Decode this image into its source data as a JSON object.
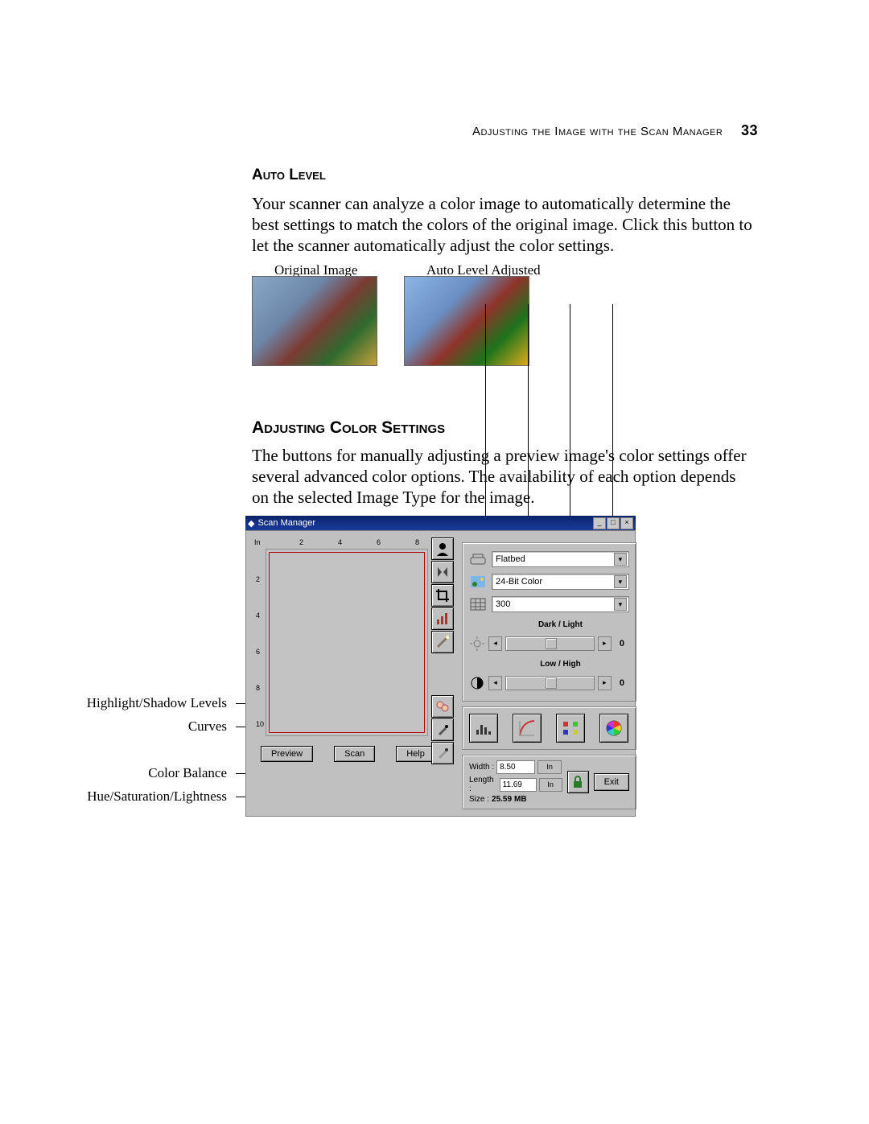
{
  "running_head": {
    "text": "Adjusting the Image with the Scan Manager",
    "page_number": "33"
  },
  "section_auto_level": {
    "heading": "Auto Level",
    "body": "Your scanner can analyze a color image to automatically determine the best settings to match the colors of the original image. Click this button to let the scanner automatically adjust the color settings.",
    "original_caption": "Original Image",
    "adjusted_caption": "Auto Level Adjusted"
  },
  "section_color_settings": {
    "heading": "Adjusting Color Settings",
    "body": "The buttons for manually adjusting a preview image's color settings offer several advanced color options. The availability of each option depends on the selected Image Type for the image."
  },
  "callouts": {
    "highlight_shadow": "Highlight/Shadow Levels",
    "curves": "Curves",
    "color_balance": "Color Balance",
    "hsl": "Hue/Saturation/Lightness"
  },
  "scan_manager": {
    "title": "Scan Manager",
    "ruler_unit_label": "In",
    "ruler_h_ticks": [
      "2",
      "4",
      "6",
      "8"
    ],
    "ruler_v_ticks": [
      "2",
      "4",
      "6",
      "8",
      "10"
    ],
    "buttons": {
      "preview": "Preview",
      "scan": "Scan",
      "help": "Help",
      "exit": "Exit"
    },
    "settings": {
      "source": "Flatbed",
      "color_mode": "24-Bit Color",
      "resolution": "300",
      "dark_light_label": "Dark / Light",
      "dark_light_value": "0",
      "low_high_label": "Low / High",
      "low_high_value": "0"
    },
    "size": {
      "width_label": "Width :",
      "width_value": "8.50",
      "length_label": "Length :",
      "length_value": "11.69",
      "unit": "In",
      "size_label": "Size :",
      "size_value": "25.59",
      "size_unit": "MB"
    },
    "tool_icons": [
      "silhouette",
      "mirror",
      "crop",
      "levels",
      "wand"
    ],
    "pickers": [
      "face-a",
      "eyedropper-a",
      "eyedropper-b"
    ],
    "adv_buttons": [
      "hist",
      "curve",
      "balance",
      "hsl-wheel"
    ]
  }
}
